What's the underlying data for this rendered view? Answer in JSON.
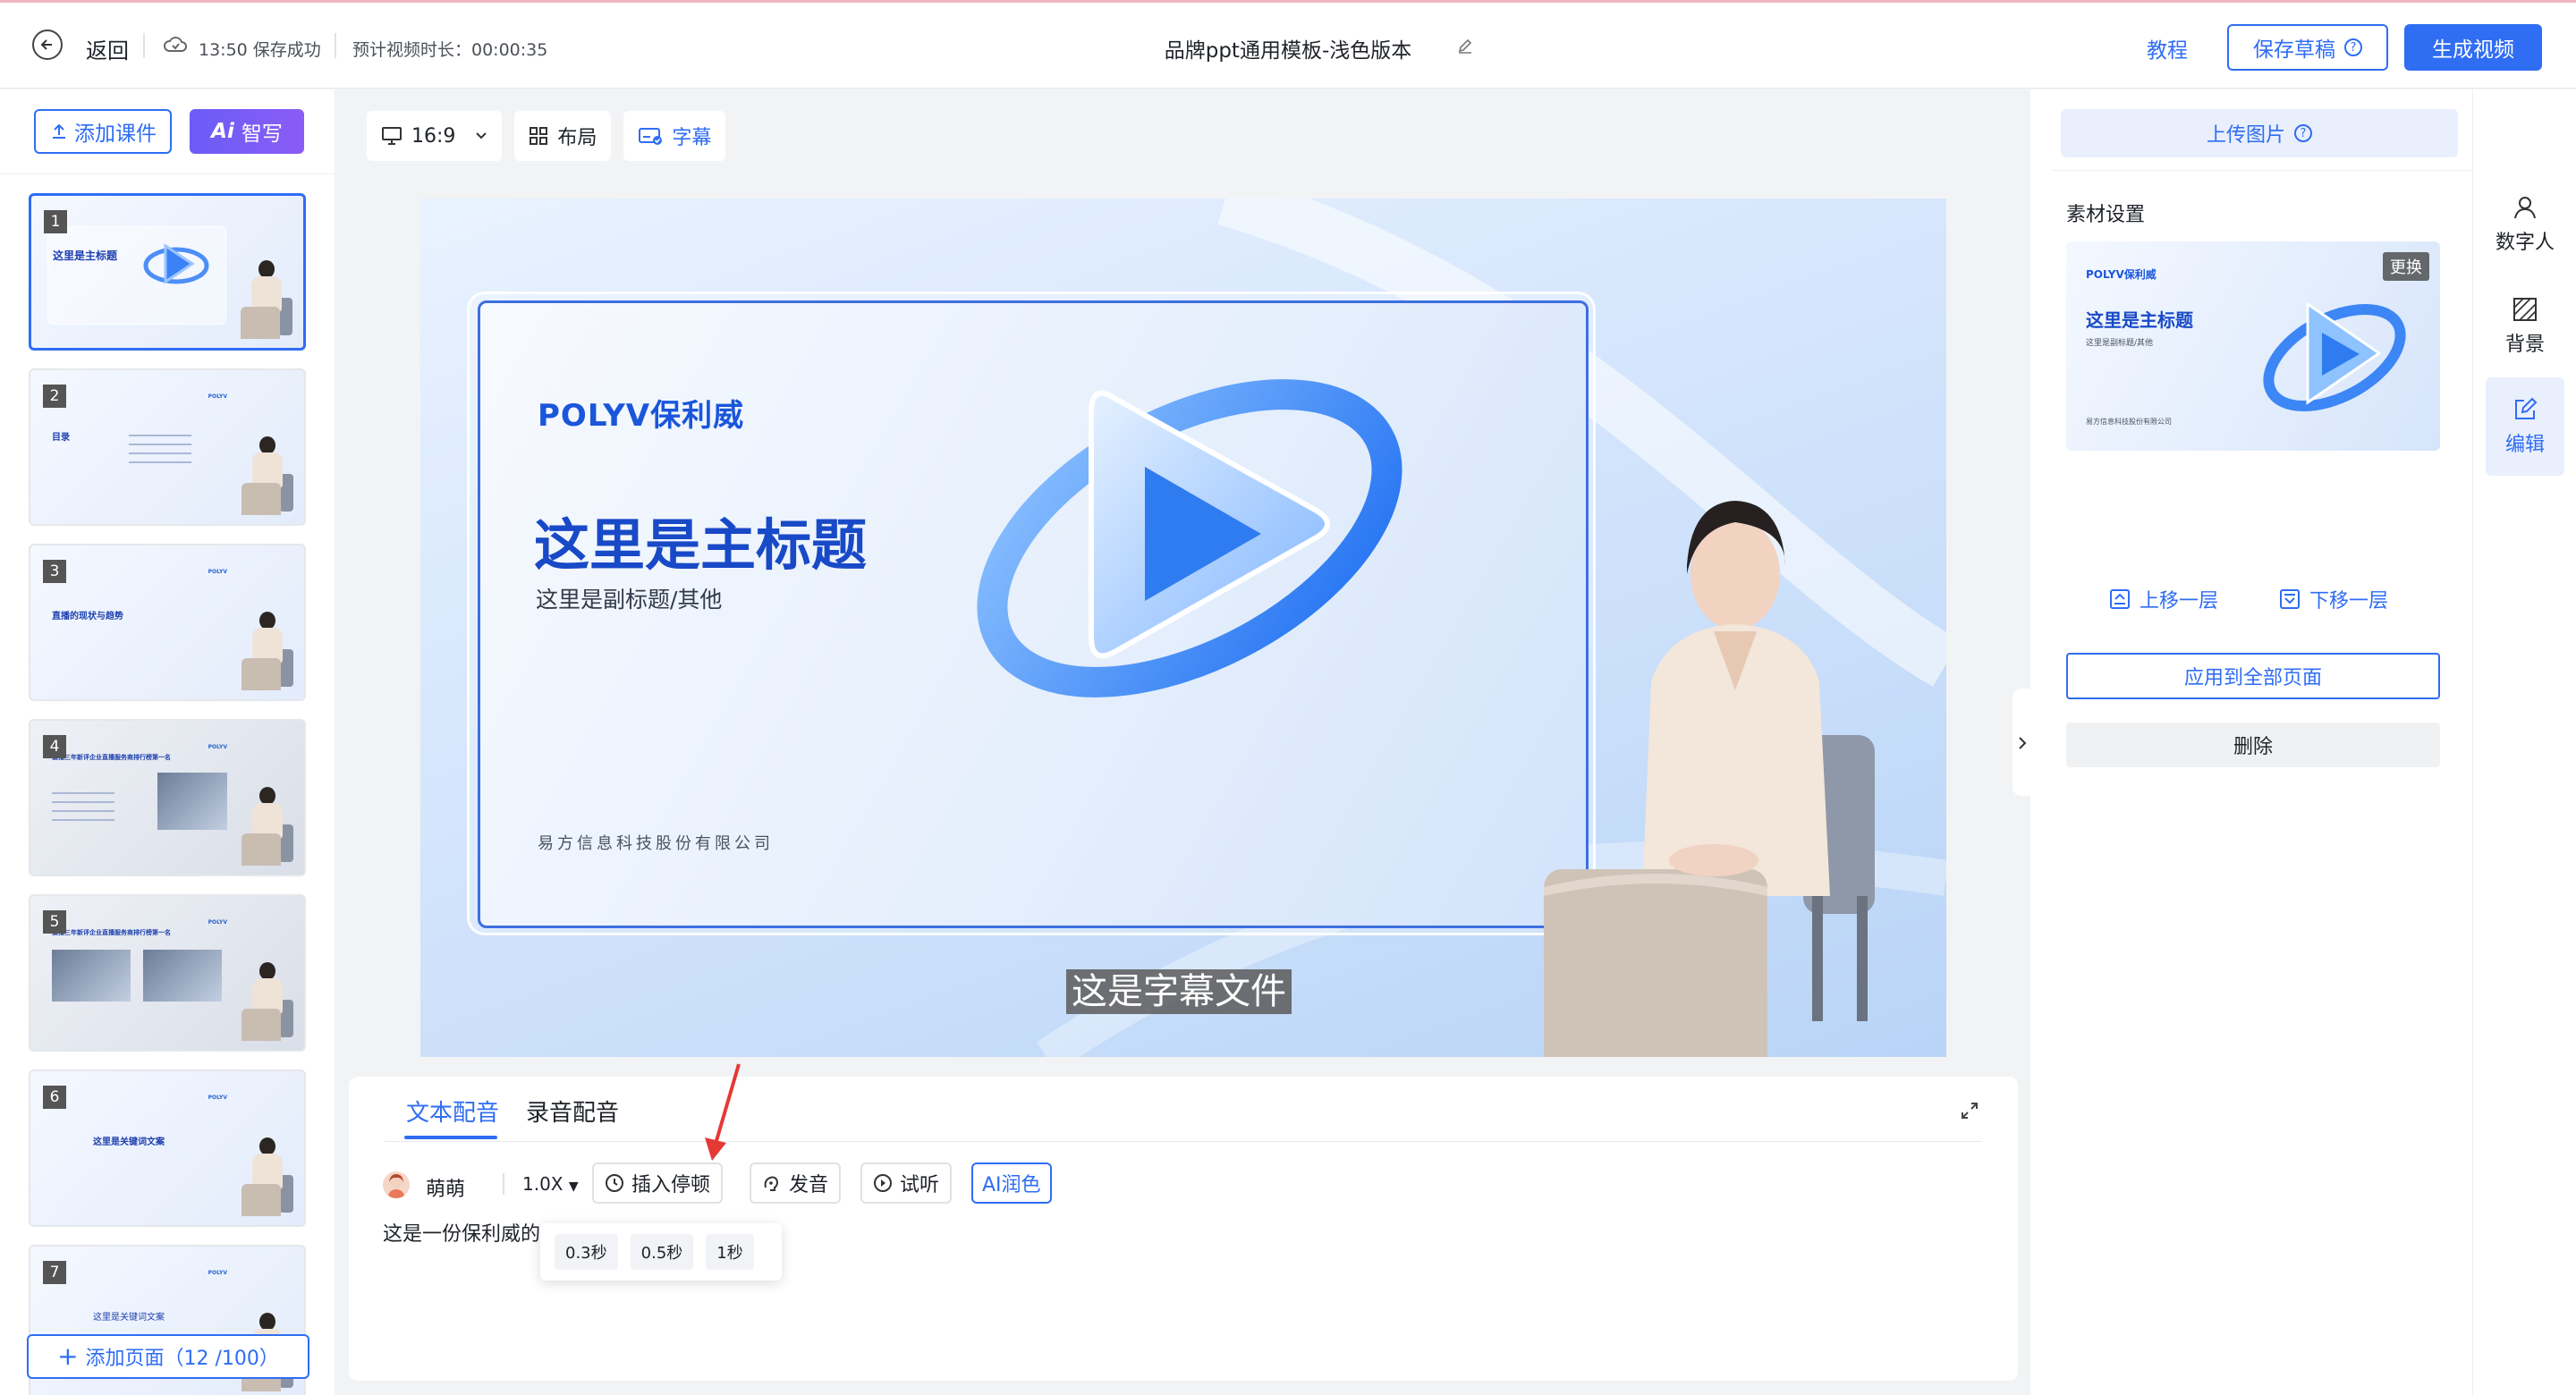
{
  "header": {
    "back_label": "返回",
    "save_status": "13:50 保存成功",
    "duration": "预计视频时长：00:00:35",
    "title": "品牌ppt通用模板-浅色版本",
    "tutorial": "教程",
    "save_draft": "保存草稿",
    "generate_video": "生成视频"
  },
  "left": {
    "add_course": "添加课件",
    "ai_write_prefix": "Ai",
    "ai_write": "智写",
    "add_page": "添加页面（12 /100）",
    "slides": [
      {
        "num": "1",
        "title": "这里是主标题"
      },
      {
        "num": "2",
        "title": "目录"
      },
      {
        "num": "3",
        "title": "直播的现状与趋势"
      },
      {
        "num": "4",
        "title": "直播三年新评企业直播服务商排行榜第一名"
      },
      {
        "num": "5",
        "title": "直播三年新评企业直播服务商排行榜第一名"
      },
      {
        "num": "6",
        "title": "这里是关键词文案"
      },
      {
        "num": "7",
        "title": "这里是关键词文案"
      }
    ]
  },
  "toolbar": {
    "ratio": "16:9",
    "layout": "布局",
    "subtitle": "字幕"
  },
  "canvas": {
    "logo": "POLYV保利威",
    "title": "这里是主标题",
    "subtitle": "这里是副标题/其他",
    "company": "易方信息科技股份有限公司",
    "caption": "这是字幕文件"
  },
  "voice": {
    "tab_text": "文本配音",
    "tab_record": "录音配音",
    "voice_name": "萌萌",
    "speed": "1.0X",
    "insert_pause": "插入停顿",
    "pronunciation": "发音",
    "listen": "试听",
    "ai_polish": "AI润色",
    "text": "这是一份保利威的",
    "pause_options": [
      "0.3秒",
      "0.5秒",
      "1秒"
    ]
  },
  "right": {
    "upload_image": "上传图片",
    "material_settings": "素材设置",
    "replace": "更换",
    "thumb_logo": "POLYV保利威",
    "thumb_title": "这里是主标题",
    "thumb_subtitle": "这里是副标题/其他",
    "thumb_company": "易方信息科技股份有限公司",
    "layer_up": "上移一层",
    "layer_down": "下移一层",
    "apply_all": "应用到全部页面",
    "delete": "删除"
  },
  "sidetabs": [
    {
      "label": "数字人",
      "icon": "person-icon"
    },
    {
      "label": "背景",
      "icon": "background-icon"
    },
    {
      "label": "编辑",
      "icon": "edit-icon"
    }
  ],
  "colors": {
    "accent": "#2f6df3",
    "ai_purple": "#7b5cf6",
    "arrow_red": "#e53935"
  }
}
